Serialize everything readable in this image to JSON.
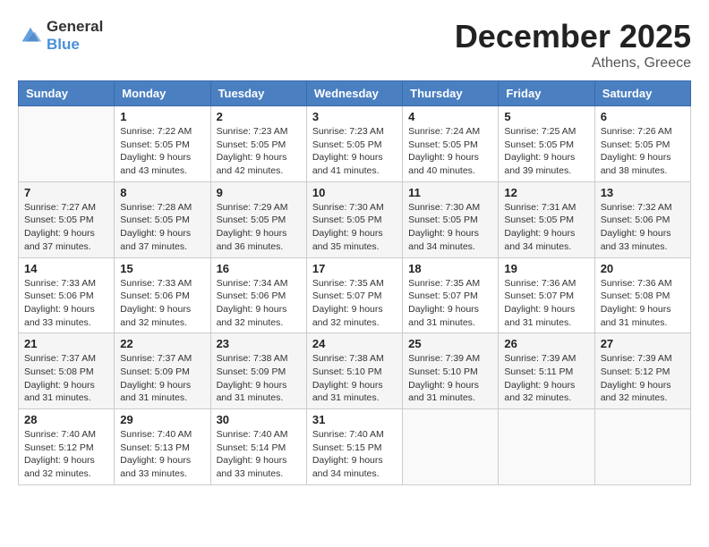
{
  "header": {
    "logo": {
      "general": "General",
      "blue": "Blue"
    },
    "month_year": "December 2025",
    "location": "Athens, Greece"
  },
  "days_of_week": [
    "Sunday",
    "Monday",
    "Tuesday",
    "Wednesday",
    "Thursday",
    "Friday",
    "Saturday"
  ],
  "weeks": [
    [
      {
        "day": "",
        "info": ""
      },
      {
        "day": "1",
        "info": "Sunrise: 7:22 AM\nSunset: 5:05 PM\nDaylight: 9 hours\nand 43 minutes."
      },
      {
        "day": "2",
        "info": "Sunrise: 7:23 AM\nSunset: 5:05 PM\nDaylight: 9 hours\nand 42 minutes."
      },
      {
        "day": "3",
        "info": "Sunrise: 7:23 AM\nSunset: 5:05 PM\nDaylight: 9 hours\nand 41 minutes."
      },
      {
        "day": "4",
        "info": "Sunrise: 7:24 AM\nSunset: 5:05 PM\nDaylight: 9 hours\nand 40 minutes."
      },
      {
        "day": "5",
        "info": "Sunrise: 7:25 AM\nSunset: 5:05 PM\nDaylight: 9 hours\nand 39 minutes."
      },
      {
        "day": "6",
        "info": "Sunrise: 7:26 AM\nSunset: 5:05 PM\nDaylight: 9 hours\nand 38 minutes."
      }
    ],
    [
      {
        "day": "7",
        "info": "Sunrise: 7:27 AM\nSunset: 5:05 PM\nDaylight: 9 hours\nand 37 minutes."
      },
      {
        "day": "8",
        "info": "Sunrise: 7:28 AM\nSunset: 5:05 PM\nDaylight: 9 hours\nand 37 minutes."
      },
      {
        "day": "9",
        "info": "Sunrise: 7:29 AM\nSunset: 5:05 PM\nDaylight: 9 hours\nand 36 minutes."
      },
      {
        "day": "10",
        "info": "Sunrise: 7:30 AM\nSunset: 5:05 PM\nDaylight: 9 hours\nand 35 minutes."
      },
      {
        "day": "11",
        "info": "Sunrise: 7:30 AM\nSunset: 5:05 PM\nDaylight: 9 hours\nand 34 minutes."
      },
      {
        "day": "12",
        "info": "Sunrise: 7:31 AM\nSunset: 5:05 PM\nDaylight: 9 hours\nand 34 minutes."
      },
      {
        "day": "13",
        "info": "Sunrise: 7:32 AM\nSunset: 5:06 PM\nDaylight: 9 hours\nand 33 minutes."
      }
    ],
    [
      {
        "day": "14",
        "info": "Sunrise: 7:33 AM\nSunset: 5:06 PM\nDaylight: 9 hours\nand 33 minutes."
      },
      {
        "day": "15",
        "info": "Sunrise: 7:33 AM\nSunset: 5:06 PM\nDaylight: 9 hours\nand 32 minutes."
      },
      {
        "day": "16",
        "info": "Sunrise: 7:34 AM\nSunset: 5:06 PM\nDaylight: 9 hours\nand 32 minutes."
      },
      {
        "day": "17",
        "info": "Sunrise: 7:35 AM\nSunset: 5:07 PM\nDaylight: 9 hours\nand 32 minutes."
      },
      {
        "day": "18",
        "info": "Sunrise: 7:35 AM\nSunset: 5:07 PM\nDaylight: 9 hours\nand 31 minutes."
      },
      {
        "day": "19",
        "info": "Sunrise: 7:36 AM\nSunset: 5:07 PM\nDaylight: 9 hours\nand 31 minutes."
      },
      {
        "day": "20",
        "info": "Sunrise: 7:36 AM\nSunset: 5:08 PM\nDaylight: 9 hours\nand 31 minutes."
      }
    ],
    [
      {
        "day": "21",
        "info": "Sunrise: 7:37 AM\nSunset: 5:08 PM\nDaylight: 9 hours\nand 31 minutes."
      },
      {
        "day": "22",
        "info": "Sunrise: 7:37 AM\nSunset: 5:09 PM\nDaylight: 9 hours\nand 31 minutes."
      },
      {
        "day": "23",
        "info": "Sunrise: 7:38 AM\nSunset: 5:09 PM\nDaylight: 9 hours\nand 31 minutes."
      },
      {
        "day": "24",
        "info": "Sunrise: 7:38 AM\nSunset: 5:10 PM\nDaylight: 9 hours\nand 31 minutes."
      },
      {
        "day": "25",
        "info": "Sunrise: 7:39 AM\nSunset: 5:10 PM\nDaylight: 9 hours\nand 31 minutes."
      },
      {
        "day": "26",
        "info": "Sunrise: 7:39 AM\nSunset: 5:11 PM\nDaylight: 9 hours\nand 32 minutes."
      },
      {
        "day": "27",
        "info": "Sunrise: 7:39 AM\nSunset: 5:12 PM\nDaylight: 9 hours\nand 32 minutes."
      }
    ],
    [
      {
        "day": "28",
        "info": "Sunrise: 7:40 AM\nSunset: 5:12 PM\nDaylight: 9 hours\nand 32 minutes."
      },
      {
        "day": "29",
        "info": "Sunrise: 7:40 AM\nSunset: 5:13 PM\nDaylight: 9 hours\nand 33 minutes."
      },
      {
        "day": "30",
        "info": "Sunrise: 7:40 AM\nSunset: 5:14 PM\nDaylight: 9 hours\nand 33 minutes."
      },
      {
        "day": "31",
        "info": "Sunrise: 7:40 AM\nSunset: 5:15 PM\nDaylight: 9 hours\nand 34 minutes."
      },
      {
        "day": "",
        "info": ""
      },
      {
        "day": "",
        "info": ""
      },
      {
        "day": "",
        "info": ""
      }
    ]
  ]
}
